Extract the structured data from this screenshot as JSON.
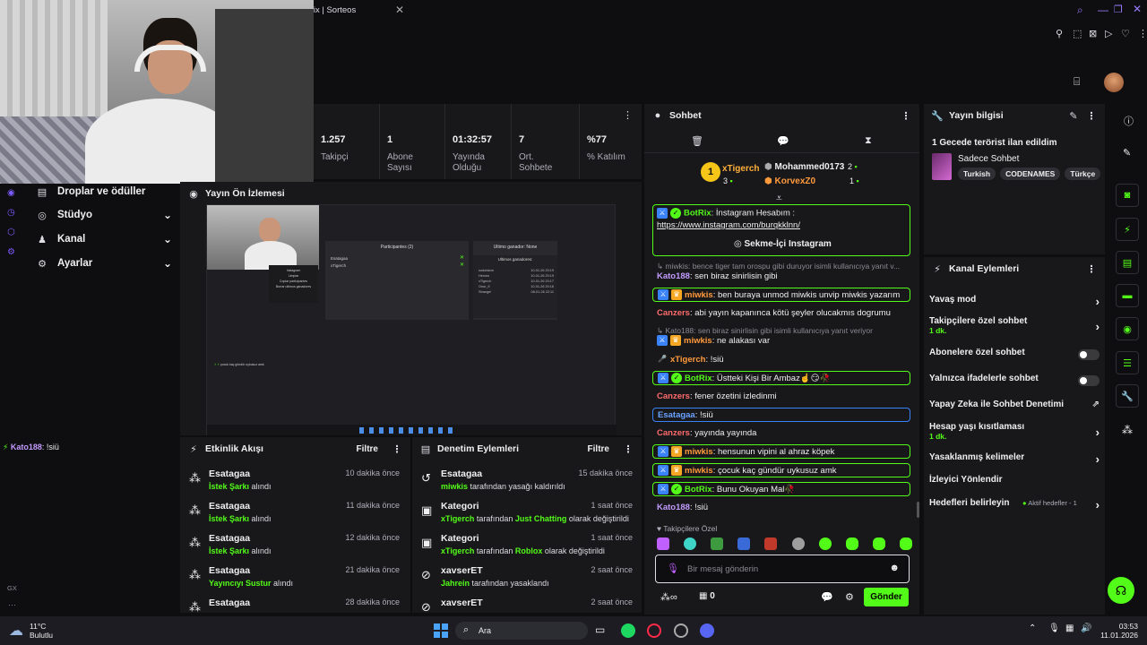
{
  "browser": {
    "tab_title": "Rix | Sorteos",
    "new_tab": "+"
  },
  "stats": [
    {
      "value": "1.257",
      "label": "Takipçi"
    },
    {
      "value": "1",
      "label": "Abone Sayısı"
    },
    {
      "value": "01:32:57",
      "label": "Yayında Olduğu"
    },
    {
      "value": "7",
      "label": "Ort. Sohbete"
    },
    {
      "value": "%77",
      "label": "% Katılım"
    }
  ],
  "nav": {
    "items": [
      {
        "label": "Droplar ve ödüller",
        "icon": "gift-icon"
      },
      {
        "label": "Stüdyo",
        "icon": "gear-icon"
      },
      {
        "label": "Kanal",
        "icon": "person-icon"
      },
      {
        "label": "Ayarlar",
        "icon": "gear-icon"
      }
    ]
  },
  "preview": {
    "title": "Yayın Ön İzlemesi",
    "participants_title": "Participantes (2)",
    "participants": [
      "Esatagaa",
      "xTigerch"
    ],
    "last_winner": "Ultimo ganador: None",
    "last_winners_title": "Ultimos ganadores:",
    "winners": [
      {
        "name": "sudoistcm",
        "date": "10-01-26 20:19"
      },
      {
        "name": "Henoiu",
        "date": "10-01-26 20:19"
      },
      {
        "name": "xTigerch",
        "date": "10-01-26 20:17"
      },
      {
        "name": "Onur_fl",
        "date": "10-01-26 20:16"
      },
      {
        "name": "Strange!",
        "date": "08-01-26 22:11"
      }
    ],
    "menu": [
      "Instagram",
      "Limpiar",
      "Copiar participantes",
      "Borrar ultimos ganadores"
    ],
    "chat_line": "çocuk kaç gündür uykusuz amk"
  },
  "overlay_chat": {
    "user": "Kato188",
    "text": ": !siü"
  },
  "left_rail": {
    "gx": "GX"
  },
  "activity": {
    "title": "Etkinlik Akışı",
    "filter": "Filtre",
    "rows": [
      {
        "user": "Esatagaa",
        "highlight": "İstek Şarkı",
        "rest": " alındı",
        "time": "10 dakika önce"
      },
      {
        "user": "Esatagaa",
        "highlight": "İstek Şarkı",
        "rest": " alındı",
        "time": "11 dakika önce"
      },
      {
        "user": "Esatagaa",
        "highlight": "İstek Şarkı",
        "rest": " alındı",
        "time": "12 dakika önce"
      },
      {
        "user": "Esatagaa",
        "highlight": "Yayıncıyı Sustur",
        "rest": " alındı",
        "time": "21 dakika önce"
      },
      {
        "user": "Esatagaa",
        "highlight": "",
        "rest": "",
        "time": "28 dakika önce"
      }
    ]
  },
  "moderation": {
    "title": "Denetim Eylemleri",
    "filter": "Filtre",
    "rows": [
      {
        "user": "Esatagaa",
        "p1": "miwkis",
        "p2": " tarafından yasağı kaldırıldı",
        "p3": "",
        "p4": "",
        "time": "15 dakika önce"
      },
      {
        "user": "Kategori",
        "p1": "xTigerch",
        "p2": " tarafından ",
        "p3": "Just Chatting",
        "p4": " olarak değiştirildi",
        "time": "1 saat önce"
      },
      {
        "user": "Kategori",
        "p1": "xTigerch",
        "p2": " tarafından ",
        "p3": "Roblox",
        "p4": " olarak değiştirildi",
        "time": "1 saat önce"
      },
      {
        "user": "xavserET",
        "p1": "Jahrein",
        "p2": " tarafından yasaklandı",
        "p3": "",
        "p4": "",
        "time": "2 saat önce"
      },
      {
        "user": "xavserET",
        "p1": "",
        "p2": "",
        "p3": "",
        "p4": "",
        "time": "2 saat önce"
      }
    ]
  },
  "chat": {
    "title": "Sohbet",
    "top": [
      {
        "rank": "1",
        "name": "xTigerch",
        "count": "3"
      },
      {
        "rank": "",
        "name": "Mohammed0173",
        "count": "2"
      },
      {
        "rank": "",
        "name": "KorvexZ0",
        "count": "1"
      }
    ],
    "pinned": {
      "user": "BotRix",
      "text": ": İnstagram Hesabım :",
      "link": "https://www.instagram.com/burqkklnn/",
      "button": "Sekme-İçi Instagram"
    },
    "messages": [
      {
        "reply": "miwkis: bence tiger tam orospu gibi duruyor isimli kullanıcıya yanıt v..."
      },
      {
        "user": "Kato188",
        "text": ": sen biraz sinirlisin gibi",
        "color": "#c39bff"
      },
      {
        "user": "miwkis",
        "text": ": ben buraya unmod miwkis unvip miwkis yazarım",
        "color": "#ff9a3c",
        "box": "green"
      },
      {
        "user": "Canzers",
        "text": ": abi yayın kapanınca kötü şeyler olucakmıs dogrumu",
        "color": "#ff6b6b"
      },
      {
        "reply": "Kato188: sen biraz sinirlisin gibi isimli kullanıcıya yanıt veriyor"
      },
      {
        "user": "miwkis",
        "text": ": ne alakası var",
        "color": "#ff9a3c"
      },
      {
        "user": "xTigerch",
        "text": ": !siü",
        "color": "#ff9a3c"
      },
      {
        "user": "BotRix",
        "text": ": Üstteki Kişi Bir Ambaz☝️😏🥀",
        "color": "#53fc18",
        "box": "green"
      },
      {
        "user": "Canzers",
        "text": ": fener özetini izledinmi",
        "color": "#ff6b6b"
      },
      {
        "user": "Esatagaa",
        "text": ": !siü",
        "color": "#6aa3ff",
        "box": "blue"
      },
      {
        "user": "Canzers",
        "text": ": yayında yayında",
        "color": "#ff6b6b"
      },
      {
        "user": "miwkis",
        "text": ": hensunun vipini al ahraz köpek",
        "color": "#ff9a3c",
        "box": "green"
      },
      {
        "user": "miwkis",
        "text": ": çocuk kaç gündür uykusuz amk",
        "color": "#ff9a3c",
        "box": "green"
      },
      {
        "user": "BotRix",
        "text": ": Bunu Okuyan Mal🥀",
        "color": "#53fc18",
        "box": "green"
      },
      {
        "user": "Kato188",
        "text": ": !siü",
        "color": "#c39bff"
      }
    ],
    "followers_only": "Takipçilere Özel",
    "placeholder": "Bir mesaj gönderin",
    "count": "0",
    "send": "Gönder"
  },
  "stream_info": {
    "title": "Yayın bilgisi",
    "stream_title": "1 Gecede terörist ilan edildim",
    "category": "Sadece Sohbet",
    "tags": [
      "Turkish",
      "CODENAMES",
      "Türkçe"
    ]
  },
  "channel_actions": {
    "title": "Kanal Eylemleri",
    "items": [
      {
        "label": "Yavaş mod",
        "sub": "",
        "ctl": "arrow"
      },
      {
        "label": "Takipçilere özel sohbet",
        "sub": "1 dk.",
        "ctl": "arrow"
      },
      {
        "label": "Abonelere özel sohbet",
        "sub": "",
        "ctl": "toggle"
      },
      {
        "label": "Yalnızca ifadelerle sohbet",
        "sub": "",
        "ctl": "toggle"
      },
      {
        "label": "Yapay Zeka ile Sohbet Denetimi",
        "sub": "",
        "ctl": "ext"
      },
      {
        "label": "Hesap yaşı kısıtlaması",
        "sub": "1 dk.",
        "ctl": "arrow"
      },
      {
        "label": "Yasaklanmış kelimeler",
        "sub": "",
        "ctl": "arrow"
      },
      {
        "label": "İzleyici Yönlendir",
        "sub": "",
        "ctl": "none"
      },
      {
        "label": "Hedefleri belirleyin",
        "sub": "",
        "ctl": "arrow",
        "extra": "Aktif hedefler - 1"
      }
    ]
  },
  "taskbar": {
    "weather_temp": "11°C",
    "weather_desc": "Bulutlu",
    "search": "Ara",
    "time": "03:53",
    "date": "11.01.2026"
  },
  "colors": {
    "accent": "#53fc18",
    "bg": "#0e0e10",
    "panel": "#18181b"
  }
}
